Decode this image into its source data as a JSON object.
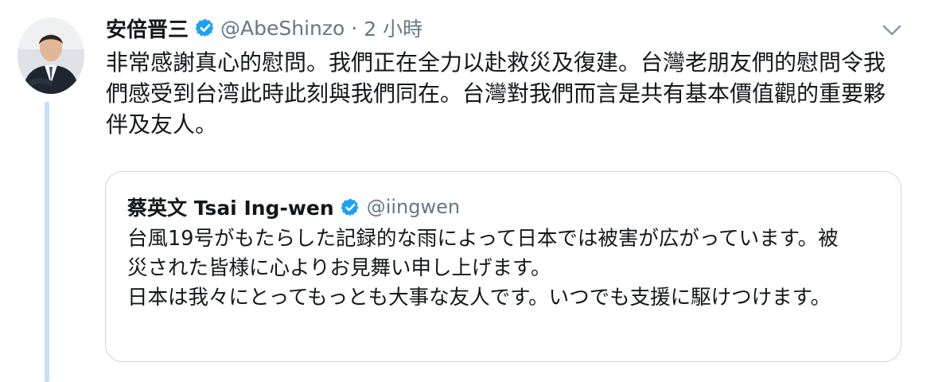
{
  "tweet": {
    "author_name": "安倍晋三",
    "author_handle": "@AbeShinzo",
    "separator": "·",
    "time": "2 小時",
    "text": "非常感謝真心的慰問。我們正在全力以赴救災及復建。台灣老朋友們的慰問令我們感受到台湾此時此刻與我們同在。台灣對我們而言是共有基本價值觀的重要夥伴及友人。",
    "avatar_icon": "profile-photo",
    "verified_icon": "verified-badge-icon",
    "menu_icon": "chevron-down-icon"
  },
  "quoted_tweet": {
    "author_name": "蔡英文 Tsai Ing-wen",
    "author_handle": "@iingwen",
    "paragraph_1": "台風19号がもたらした記録的な雨によって日本では被害が広がっています。被災された皆様に心よりお見舞い申し上げます。",
    "paragraph_2": "日本は我々にとってもっとも大事な友人です。いつでも支援に駆けつけます。",
    "verified_icon": "verified-badge-icon"
  },
  "colors": {
    "text_primary": "#14171a",
    "text_secondary": "#657786",
    "verified_blue": "#1da1f2",
    "thread_line": "#c4dff6",
    "card_border": "#ccd6dd"
  }
}
